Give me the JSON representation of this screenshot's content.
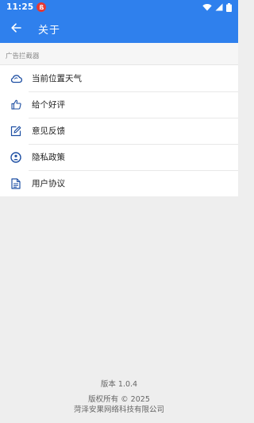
{
  "status_bar": {
    "time": "11:25",
    "notification_badge": "ß",
    "icons": [
      "wifi-icon",
      "signal-icon",
      "battery-icon"
    ]
  },
  "app_bar": {
    "title": "关于",
    "back_icon": "back-arrow-icon"
  },
  "section_header": "广告拦截器",
  "menu": {
    "items": [
      {
        "label": "当前位置天气",
        "icon": "weather-icon"
      },
      {
        "label": "给个好评",
        "icon": "thumbs-up-icon"
      },
      {
        "label": "意见反馈",
        "icon": "edit-icon"
      },
      {
        "label": "隐私政策",
        "icon": "privacy-icon"
      },
      {
        "label": "用户协议",
        "icon": "document-icon"
      }
    ]
  },
  "footer": {
    "version": "版本 1.0.4",
    "copyright": "版权所有 © 2025",
    "company": "菏泽安果网络科技有限公司"
  },
  "colors": {
    "primary": "#2f80ed",
    "icon_blue": "#1e4fa3",
    "background": "#eeeeee"
  }
}
